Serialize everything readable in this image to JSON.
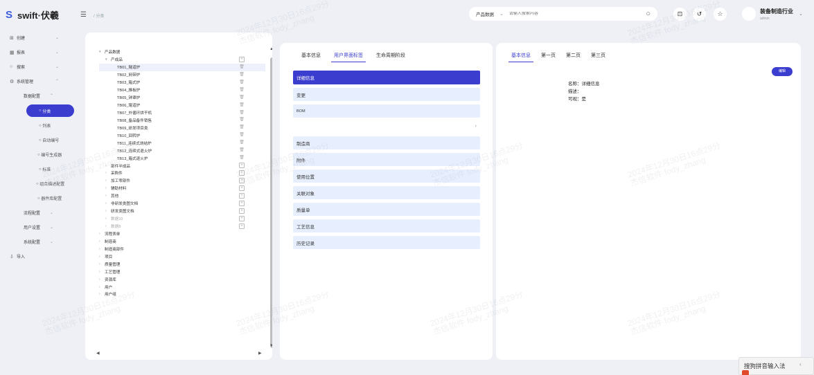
{
  "app": {
    "logo_text": "swift·伏羲",
    "breadcrumb": "/ 分类"
  },
  "search": {
    "category": "产品数据",
    "placeholder": "请输入搜索内容"
  },
  "user": {
    "name": "装备制造行业",
    "role": "admin"
  },
  "sidebar": {
    "items": [
      {
        "label": "创建",
        "icon": "create-icon"
      },
      {
        "label": "报表",
        "icon": "report-icon"
      },
      {
        "label": "搜索",
        "icon": "search-icon"
      },
      {
        "label": "系统管理",
        "icon": "settings-icon"
      }
    ],
    "data_config": "数据配置",
    "data_config_children": [
      "分类",
      "列表",
      "自动编号",
      "编号生成器",
      "标准",
      "组合描述配置",
      "器件库配置"
    ],
    "groups": [
      "流程配置",
      "用户设置",
      "系统配置"
    ],
    "import": "导入"
  },
  "tree": [
    {
      "label": "产品数据",
      "arrow": "▾",
      "indent": 0
    },
    {
      "label": "产成品",
      "arrow": "▾",
      "indent": 1,
      "action": "add"
    },
    {
      "label": "TB01_隧道炉",
      "indent": 2,
      "action": "del",
      "selected": true
    },
    {
      "label": "TB02_网带炉",
      "indent": 2,
      "action": "del"
    },
    {
      "label": "TB03_箱式炉",
      "indent": 2,
      "action": "del"
    },
    {
      "label": "TB04_推板炉",
      "indent": 2,
      "action": "del"
    },
    {
      "label": "TB05_钟罩炉",
      "indent": 2,
      "action": "del"
    },
    {
      "label": "TB06_辊道炉",
      "indent": 2,
      "action": "del"
    },
    {
      "label": "TB07_外循环烘干机",
      "indent": 2,
      "action": "del"
    },
    {
      "label": "TB08_备品备件销售",
      "indent": 2,
      "action": "del"
    },
    {
      "label": "TB09_研发项目类",
      "indent": 2,
      "action": "del"
    },
    {
      "label": "TB10_回转炉",
      "indent": 2,
      "action": "del"
    },
    {
      "label": "TB11_连续式烧结炉",
      "indent": 2,
      "action": "del"
    },
    {
      "label": "TB12_连续式退火炉",
      "indent": 2,
      "action": "del"
    },
    {
      "label": "TB13_箱式退火炉",
      "indent": 2,
      "action": "del"
    },
    {
      "label": "部件半成品",
      "arrow": "›",
      "indent": 1,
      "action": "add"
    },
    {
      "label": "采购件",
      "arrow": "›",
      "indent": 1,
      "action": "add"
    },
    {
      "label": "加工零部件",
      "arrow": "›",
      "indent": 1,
      "action": "add"
    },
    {
      "label": "辅助材料",
      "arrow": "›",
      "indent": 1,
      "action": "add"
    },
    {
      "label": "其他",
      "arrow": "›",
      "indent": 1,
      "action": "add"
    },
    {
      "label": "非研发类图文档",
      "arrow": "›",
      "indent": 1,
      "action": "add"
    },
    {
      "label": "研发类图文档",
      "arrow": "›",
      "indent": 1,
      "action": "add"
    },
    {
      "label": "数据10",
      "arrow": "›",
      "indent": 1,
      "action": "add",
      "dim": true
    },
    {
      "label": "数据8",
      "arrow": "›",
      "indent": 1,
      "action": "add",
      "dim": true
    },
    {
      "label": "流程表单",
      "arrow": "›",
      "indent": 0
    },
    {
      "label": "制造商",
      "arrow": "›",
      "indent": 0
    },
    {
      "label": "制造商部件",
      "arrow": "›",
      "indent": 0
    },
    {
      "label": "项目",
      "arrow": "›",
      "indent": 0
    },
    {
      "label": "质量管理",
      "arrow": "›",
      "indent": 0
    },
    {
      "label": "工艺管理",
      "arrow": "›",
      "indent": 0
    },
    {
      "label": "资源库",
      "arrow": "›",
      "indent": 0
    },
    {
      "label": "用户",
      "arrow": "›",
      "indent": 0
    },
    {
      "label": "用户组",
      "arrow": "›",
      "indent": 0
    }
  ],
  "middle": {
    "tabs": [
      "基本信息",
      "用户界面标签",
      "生命周期阶段"
    ],
    "active_tab": 1,
    "cards": [
      "详细信息",
      "变更",
      "BOM",
      "制造商",
      "附件",
      "使用位置",
      "关联对象",
      "质量单",
      "工艺信息",
      "历史记录"
    ]
  },
  "right": {
    "tabs": [
      "基本信息",
      "第一页",
      "第二页",
      "第三页"
    ],
    "active_tab": 0,
    "edit_label": "编辑",
    "fields": [
      "名称：详细信息",
      "描述：",
      "可视：是"
    ]
  },
  "ime": {
    "label": "搜狗拼音输入法",
    "arrow": "‹"
  },
  "watermark": {
    "line1": "2024年12月30日16点29分",
    "line2": "杰信软件 fody_zhang"
  },
  "colors": {
    "accent": "#3b3dcf",
    "card_bg": "#e7efff",
    "page_bg": "#eef0f6"
  }
}
